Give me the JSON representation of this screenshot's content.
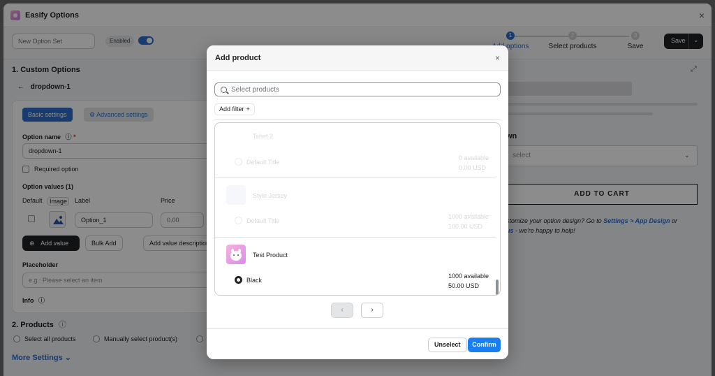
{
  "window": {
    "title": "Easify Options",
    "close": "×"
  },
  "topbar": {
    "option_set_name": "New Option Set",
    "enabled_label": "Enabled",
    "steps": [
      {
        "num": "1",
        "label": "Add options"
      },
      {
        "num": "2",
        "label": "Select products"
      },
      {
        "num": "3",
        "label": "Save"
      }
    ],
    "save_label": "Save",
    "save_caret": "⌄"
  },
  "left": {
    "section1": "1. Custom Options",
    "back_arrow": "←",
    "option_title": "dropdown-1",
    "tab_basic": "Basic settings",
    "tab_advanced": "Advanced settings",
    "option_name_label": "Option name",
    "option_name_value": "dropdown-1",
    "required_label": "Required option",
    "values_label": "Option values (1)",
    "col_default": "Default",
    "col_image": "Image",
    "col_label": "Label",
    "col_price": "Price",
    "value_label": "Option_1",
    "value_price": "0.00",
    "add_value": "Add value",
    "bulk_add": "Bulk Add",
    "add_desc": "Add value description",
    "placeholder_label": "Placeholder",
    "placeholder_hint": "e.g.: Please select an item",
    "info_label": "Info",
    "section2": "2. Products",
    "select_all": "Select all products",
    "manual_select": "Manually select product(s)",
    "more_settings": "More Settings",
    "more_caret": "⌄"
  },
  "right": {
    "option_heading": "wn",
    "select_placeholder": "select",
    "add_to_cart": "ADD TO CART",
    "help_prefix": "stomize your option design? Go to ",
    "help_link1": "Settings > App Design",
    "help_mid": " or",
    "help_link2": "us",
    "help_suffix": " - we're happy to help!"
  },
  "modal": {
    "title": "Add product",
    "close": "×",
    "search_placeholder": "Select products",
    "filter_label": "Add filter",
    "filter_plus": "+",
    "products": [
      {
        "name": "Tshirt 2",
        "variant": "Default Title",
        "available": "0 available",
        "price": "0.00 USD",
        "selected": false,
        "disabled": true
      },
      {
        "name": "Style Jersey",
        "variant": "Default Title",
        "available": "1000 available",
        "price": "100.00 USD",
        "selected": false,
        "disabled": true
      },
      {
        "name": "Test Product",
        "variant": "Black",
        "available": "1000 available",
        "price": "50.00 USD",
        "selected": true,
        "disabled": false
      }
    ],
    "prev": "‹",
    "next": "›",
    "unselect": "Unselect",
    "confirm": "Confirm"
  },
  "colors": {
    "primary": "#2c6ecb",
    "confirm": "#1a7ef0",
    "dark": "#202223"
  }
}
